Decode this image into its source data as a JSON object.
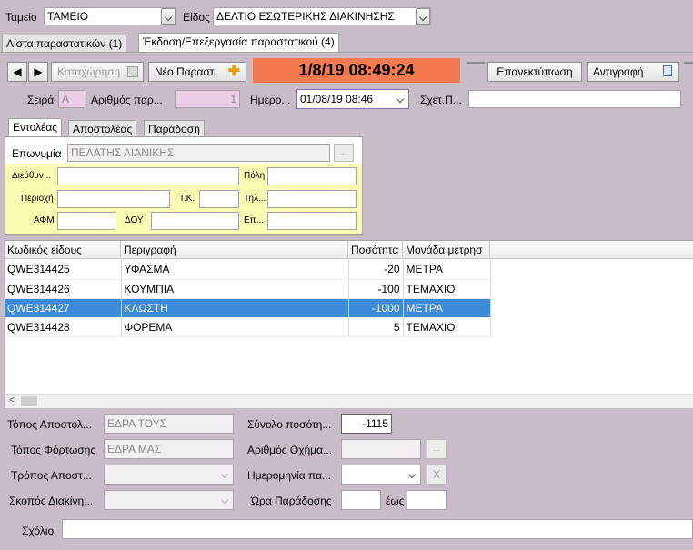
{
  "top": {
    "tameio_label": "Ταμείο",
    "tameio_value": "ΤΑΜΕΙΟ",
    "eidos_label": "Είδος",
    "eidos_value": "ΔΕΛΤΙΟ ΕΣΩΤΕΡΙΚΗΣ ΔΙΑΚΙΝΗΣΗΣ"
  },
  "tabs": [
    {
      "label": "Λίστα παραστατικών (1)"
    },
    {
      "label": "Έκδοση/Επεξεργασία παραστατικού (4)"
    }
  ],
  "toolbar": {
    "katachorisi": "Καταχώρηση",
    "neo": "Νέο Παραστ.",
    "datetime": "1/8/19 08:49:24",
    "epanektyposi": "Επανεκτύπωση",
    "antigrafi": "Αντιγραφή"
  },
  "fields": {
    "seira_label": "Σειρά",
    "seira_value": "Α",
    "arithmos_label": "Αριθμός παρ...",
    "arithmos_value": "1",
    "imerominia_label": "Ημερο...",
    "imerominia_value": "01/08/19 08:46",
    "schet_label": "Σχετ.Π..."
  },
  "subtabs": [
    {
      "label": "Εντολέας"
    },
    {
      "label": "Αποστολέας"
    },
    {
      "label": "Παράδοση"
    }
  ],
  "entoleas": {
    "eponymia_label": "Επωνυμία",
    "eponymia_value": "ΠΕΛΑΤΗΣ ΛΙΑΝΙΚΗΣ",
    "dieuth_label": "Διεύθυν...",
    "poli_label": "Πόλη",
    "perioxi_label": "Περιοχή",
    "tk_label": "Τ.Κ.",
    "til_label": "Τηλ...",
    "afm_label": "ΑΦΜ",
    "doy_label": "ΔΟΥ",
    "ep_label": "Επ..."
  },
  "grid": {
    "headers": [
      "Κωδικός είδους",
      "Περιγραφή",
      "Ποσότητα",
      "Μονάδα μέτρησ"
    ],
    "rows": [
      {
        "code": "QWE314425",
        "desc": "ΥΦΑΣΜΑ",
        "qty": "-20",
        "unit": "ΜΕΤΡΑ"
      },
      {
        "code": "QWE314426",
        "desc": "ΚΟΥΜΠΙΑ",
        "qty": "-100",
        "unit": "ΤΕΜΑΧΙΟ"
      },
      {
        "code": "QWE314427",
        "desc": "ΚΛΩΣΤΗ",
        "qty": "-1000",
        "unit": "ΜΕΤΡΑ"
      },
      {
        "code": "QWE314428",
        "desc": "ΦΟΡΕΜΑ",
        "qty": "5",
        "unit": "ΤΕΜΑΧΙΟ"
      }
    ],
    "selected_index": 2
  },
  "bottom": {
    "topos_apost_label": "Τόπος Αποστολ...",
    "topos_apost_value": "ΕΔΡΑ ΤΟΥΣ",
    "topos_fort_label": "Τόπος Φόρτωσης",
    "topos_fort_value": "ΕΔΡΑ ΜΑΣ",
    "tropos_label": "Τρόπος Αποστ...",
    "skopos_label": "Σκοπός Διακίνη...",
    "synolo_label": "Σύνολο ποσότη...",
    "synolo_value": "-1115",
    "oxima_label": "Αριθμός Οχήμα...",
    "imer_par_label": "Ημερομηνία πα...",
    "ora_label": "Ώρα Παράδοσης",
    "eos_label": "έως",
    "sxolio_label": "Σχόλιο",
    "dots": "...",
    "x": "X"
  },
  "colors": {
    "background": "#c8bcc8",
    "datetime_bg": "#f47a50",
    "pink_field": "#eecde8",
    "yellow_panel": "#fbfbb4",
    "selected_row": "#3d8ad8"
  }
}
